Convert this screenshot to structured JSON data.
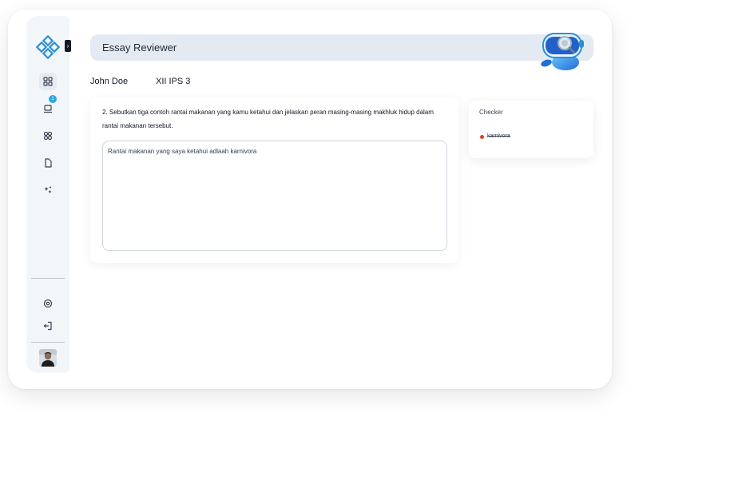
{
  "app": {
    "title": "Essay Reviewer"
  },
  "student": {
    "name": "John Doe",
    "class": "XII IPS 3"
  },
  "sidebar": {
    "collapse_icon": "chevron-right-icon",
    "items": [
      {
        "icon": "grid-icon",
        "active": true
      },
      {
        "icon": "laptop-icon",
        "badge": "1"
      },
      {
        "icon": "apps-icon"
      },
      {
        "icon": "document-icon"
      },
      {
        "icon": "sparkle-icon"
      }
    ],
    "bottom_items": [
      {
        "icon": "settings-icon"
      },
      {
        "icon": "logout-icon"
      }
    ]
  },
  "question": {
    "text": "2. Sebutkan tiga contoh rantai makanan yang kamu ketahui dan jelaskan peran masing-masing makhluk hidup dalam rantai makanan tersebut."
  },
  "answer": {
    "value": "Rantai makanan yang saya ketahui adlaah karnivora"
  },
  "checker": {
    "title": "Checker",
    "items": [
      {
        "text": "karnivora",
        "status_color": "#e2401c"
      }
    ]
  },
  "colors": {
    "accent": "#2aa7e8",
    "header_bg": "#e4eaf1",
    "error": "#e2401c"
  }
}
